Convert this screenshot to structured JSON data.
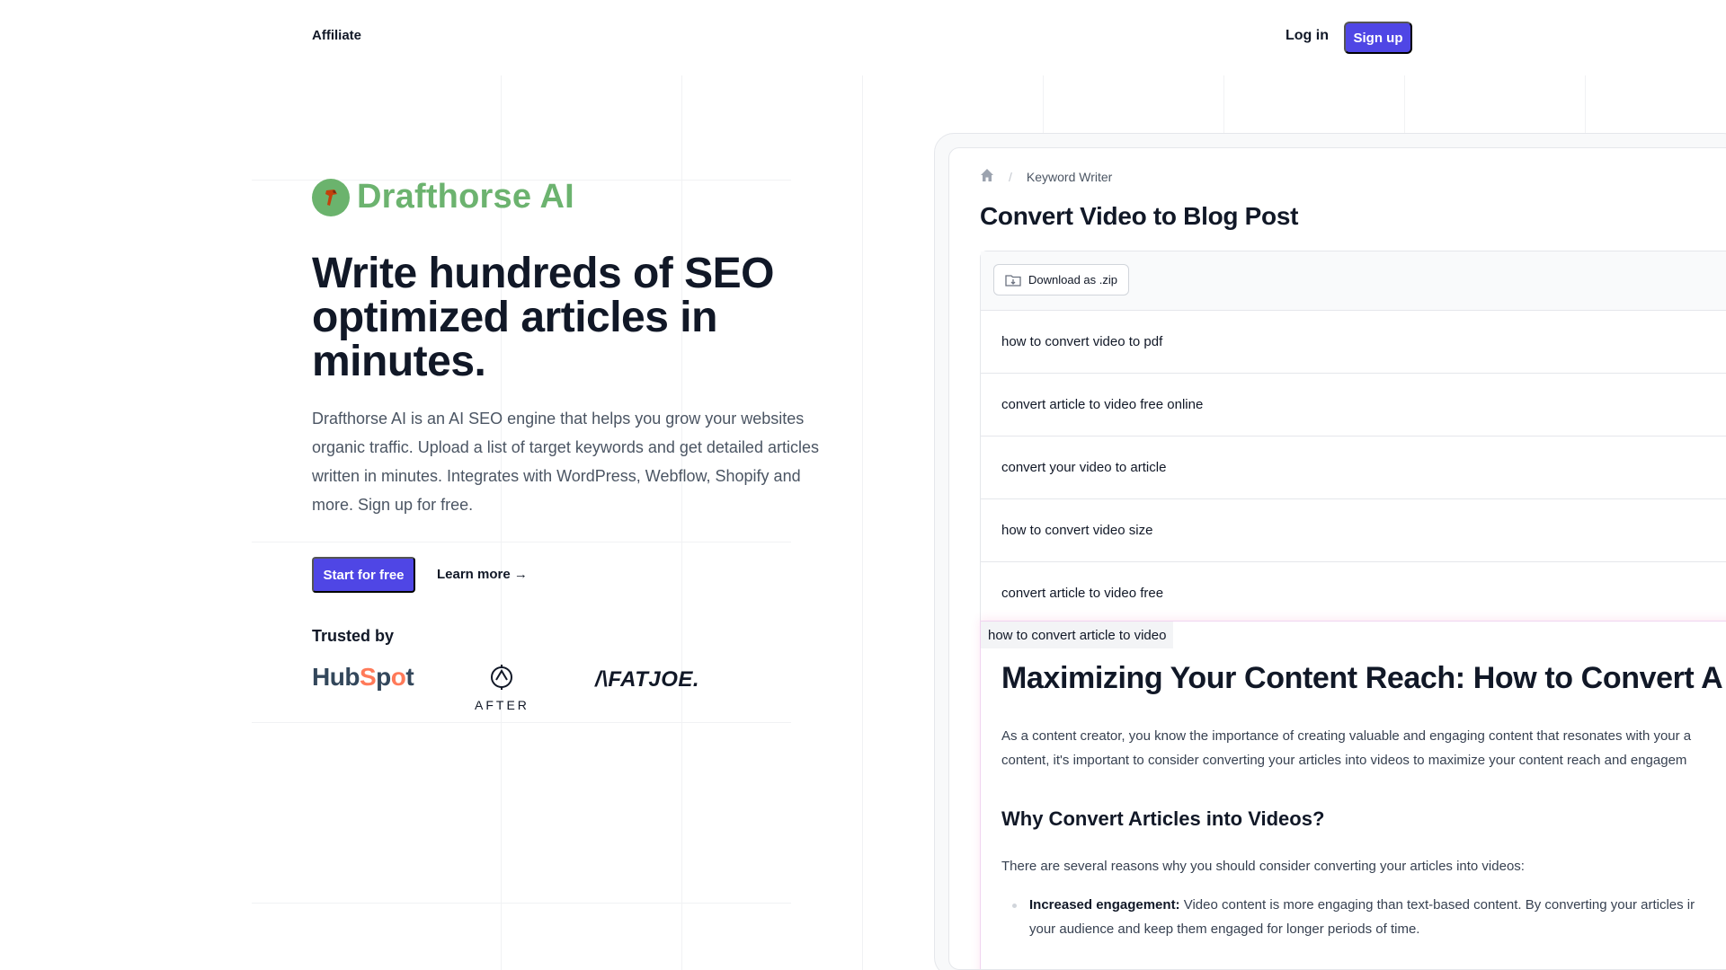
{
  "nav": {
    "affiliate": "Affiliate",
    "login": "Log in",
    "signup": "Sign up"
  },
  "brand": {
    "name": "Drafthorse AI"
  },
  "hero": {
    "title": "Write hundreds of SEO optimized articles in minutes.",
    "description": "Drafthorse AI is an AI SEO engine that helps you grow your websites organic traffic. Upload a list of target keywords and get detailed articles written in minutes. Integrates with WordPress, Webflow, Shopify and more. Sign up for free.",
    "start_button": "Start for free",
    "learn_more": "Learn more →"
  },
  "trusted": {
    "label": "Trusted by",
    "logos": [
      "HubSpot",
      "AFTER",
      "/\\FATJOE."
    ]
  },
  "app": {
    "breadcrumb": {
      "current": "Keyword Writer"
    },
    "title": "Convert Video to Blog Post",
    "download_button": "Download as .zip",
    "keywords": [
      "how to convert video to pdf",
      "convert article to video free online",
      "convert your video to article",
      "how to convert video size",
      "convert article to video free"
    ],
    "article": {
      "tag": "how to convert article to video",
      "h1": "Maximizing Your Content Reach: How to Convert A",
      "intro_line1": "As a content creator, you know the importance of creating valuable and engaging content that resonates with your a",
      "intro_line2": "content, it's important to consider converting your articles into videos to maximize your content reach and engagem",
      "h2": "Why Convert Articles into Videos?",
      "p2": "There are several reasons why you should consider converting your articles into videos:",
      "li_bold": "Increased engagement:",
      "li_line1": " Video content is more engaging than text-based content. By converting your articles ir",
      "li_line2": "your audience and keep them engaged for longer periods of time."
    }
  },
  "colors": {
    "accent": "#4f46e5",
    "brand_green": "#6cb36f",
    "hubspot_orange": "#ff7a59"
  }
}
